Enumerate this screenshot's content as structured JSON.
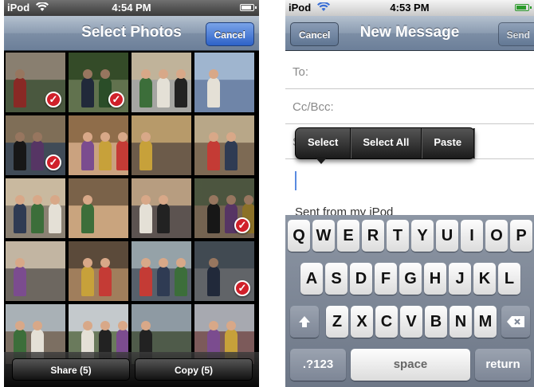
{
  "left_screen": {
    "status": {
      "carrier": "iPod",
      "time": "4:54 PM"
    },
    "title": "Select Photos",
    "cancel_label": "Cancel",
    "photos_selected": [
      true,
      true,
      false,
      false,
      true,
      false,
      false,
      false,
      false,
      false,
      false,
      true,
      false,
      false,
      false,
      true,
      false,
      false,
      false,
      false
    ],
    "toolbar": {
      "share_label": "Share (5)",
      "copy_label": "Copy (5)"
    }
  },
  "right_screen": {
    "status": {
      "carrier": "iPod",
      "time": "4:53 PM"
    },
    "title": "New Message",
    "cancel_label": "Cancel",
    "send_label": "Send",
    "fields": {
      "to_label": "To:",
      "ccbcc_label": "Cc/Bcc:",
      "subject_label": "S"
    },
    "body_signature": "Sent from my iPod",
    "edit_menu": {
      "select": "Select",
      "select_all": "Select All",
      "paste": "Paste"
    },
    "keyboard": {
      "row1": [
        "Q",
        "W",
        "E",
        "R",
        "T",
        "Y",
        "U",
        "I",
        "O",
        "P"
      ],
      "row2": [
        "A",
        "S",
        "D",
        "F",
        "G",
        "H",
        "J",
        "K",
        "L"
      ],
      "row3": [
        "Z",
        "X",
        "C",
        "V",
        "B",
        "N",
        "M"
      ],
      "numbers_label": ".?123",
      "space_label": "space",
      "return_label": "return"
    }
  },
  "colors": {
    "nav_blue": "#6c7f99",
    "check_red": "#d0202a",
    "keyboard_bg": "#7d8696"
  }
}
